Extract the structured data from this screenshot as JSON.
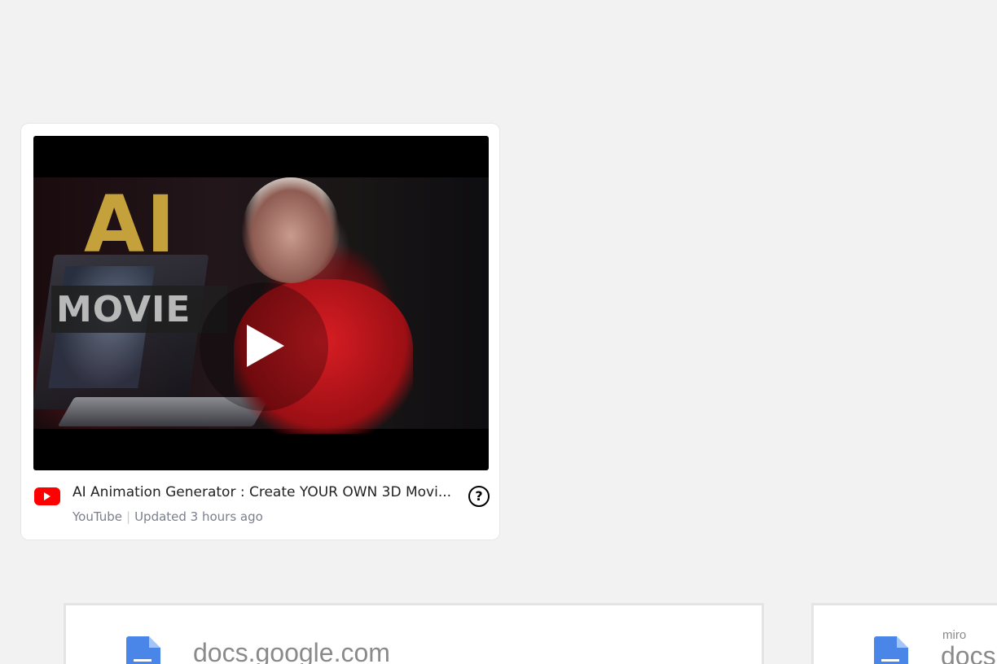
{
  "video_card": {
    "thumbnail_text": {
      "line1": "AI",
      "line2": "MOVIE"
    },
    "title": "AI Animation Generator : Create YOUR OWN 3D Movi...",
    "source": "YouTube",
    "separator": "|",
    "updated": "Updated 3 hours ago",
    "help_symbol": "?",
    "icons": {
      "source": "youtube-icon",
      "play": "play-icon",
      "help": "help-icon"
    }
  },
  "link_cards": [
    {
      "domain": "docs.google.com",
      "icon": "google-docs-icon"
    },
    {
      "brand": "miro",
      "domain": "docs",
      "icon": "google-docs-icon"
    }
  ],
  "colors": {
    "background": "#f2f2f2",
    "youtube_red": "#ff0000",
    "docs_blue": "#4a86e8",
    "ai_text_gold": "#c4a13a"
  }
}
